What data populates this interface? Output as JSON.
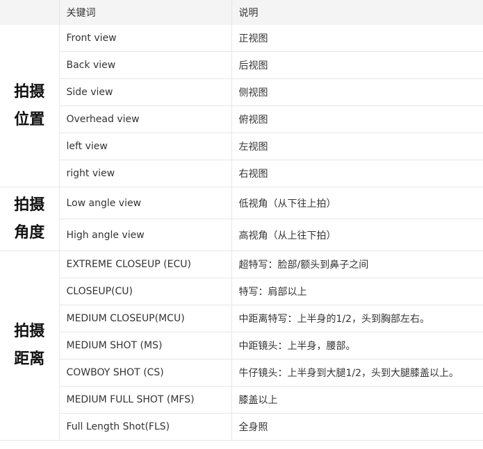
{
  "header": {
    "col0": "",
    "col1": "关键词",
    "col2": "说明"
  },
  "groups": [
    {
      "label_line1": "拍摄",
      "label_line2": "位置",
      "rows": [
        {
          "keyword": "Front view",
          "desc": "正视图"
        },
        {
          "keyword": "Back view",
          "desc": "后视图"
        },
        {
          "keyword": "Side view",
          "desc": "侧视图"
        },
        {
          "keyword": "Overhead view",
          "desc": "俯视图"
        },
        {
          "keyword": "left view",
          "desc": "左视图"
        },
        {
          "keyword": "right view",
          "desc": "右视图"
        }
      ]
    },
    {
      "label_line1": "拍摄",
      "label_line2": "角度",
      "rows": [
        {
          "keyword": "Low angle view",
          "desc": "低视角（从下往上拍）"
        },
        {
          "keyword": "High angle view",
          "desc": "高视角（从上往下拍）"
        }
      ]
    },
    {
      "label_line1": "拍摄",
      "label_line2": "距离",
      "rows": [
        {
          "keyword": "EXTREME CLOSEUP (ECU)",
          "desc": "超特写：脸部/额头到鼻子之间"
        },
        {
          "keyword": "CLOSEUP(CU)",
          "desc": "特写：肩部以上"
        },
        {
          "keyword": "MEDIUM CLOSEUP(MCU)",
          "desc": "中距离特写：上半身的1/2，头到胸部左右。"
        },
        {
          "keyword": "MEDIUM SHOT (MS)",
          "desc": "中距镜头：上半身，腰部。"
        },
        {
          "keyword": "COWBOY SHOT (CS)",
          "desc": "牛仔镜头：上半身到大腿1/2，头到大腿膝盖以上。"
        },
        {
          "keyword": "MEDIUM FULL SHOT (MFS)",
          "desc": "膝盖以上"
        },
        {
          "keyword": "Full Length Shot(FLS)",
          "desc": "全身照"
        }
      ]
    }
  ]
}
